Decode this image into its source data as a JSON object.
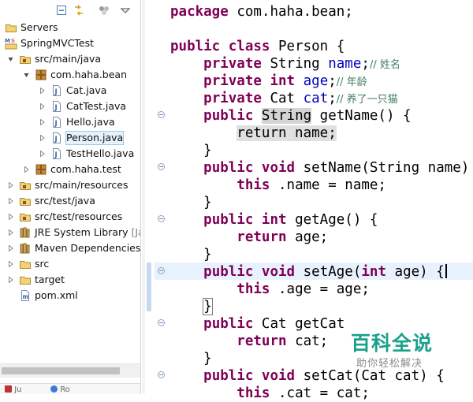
{
  "explorer": {
    "toolbar_icons": [
      "collapse-all-icon",
      "link-with-editor-icon",
      "focus-task-icon",
      "view-menu-icon"
    ],
    "items": [
      {
        "id": "servers",
        "label": "Servers",
        "icon": "folder-icon",
        "arrow": "",
        "indent": 0
      },
      {
        "id": "springmvctest",
        "label": "SpringMVCTest",
        "icon": "web-project-icon",
        "arrow": "",
        "indent": 0
      },
      {
        "id": "src-main-java",
        "label": "src/main/java",
        "icon": "source-folder-icon",
        "arrow": "expanded",
        "indent": 1
      },
      {
        "id": "com-haha-bean",
        "label": "com.haha.bean",
        "icon": "package-icon",
        "arrow": "expanded",
        "indent": 2
      },
      {
        "id": "cat-java",
        "label": "Cat.java",
        "icon": "java-file-icon",
        "arrow": "collapsed",
        "indent": 3
      },
      {
        "id": "cattest-java",
        "label": "CatTest.java",
        "icon": "java-file-icon",
        "arrow": "collapsed",
        "indent": 3
      },
      {
        "id": "hello-java",
        "label": "Hello.java",
        "icon": "java-file-icon",
        "arrow": "collapsed",
        "indent": 3
      },
      {
        "id": "person-java",
        "label": "Person.java",
        "icon": "java-file-icon",
        "arrow": "collapsed",
        "indent": 3,
        "selected": true
      },
      {
        "id": "testhello-java",
        "label": "TestHello.java",
        "icon": "java-file-icon",
        "arrow": "collapsed",
        "indent": 3
      },
      {
        "id": "com-haha-test",
        "label": "com.haha.test",
        "icon": "package-icon",
        "arrow": "collapsed",
        "indent": 2
      },
      {
        "id": "src-main-resources",
        "label": "src/main/resources",
        "icon": "source-folder-icon",
        "arrow": "collapsed",
        "indent": 1
      },
      {
        "id": "src-test-java",
        "label": "src/test/java",
        "icon": "source-folder-icon",
        "arrow": "collapsed",
        "indent": 1
      },
      {
        "id": "src-test-resources",
        "label": "src/test/resources",
        "icon": "source-folder-icon",
        "arrow": "collapsed",
        "indent": 1
      },
      {
        "id": "jre-system-library",
        "label": "JRE System Library ",
        "suffix": "[Ja",
        "icon": "library-icon",
        "arrow": "collapsed",
        "indent": 1
      },
      {
        "id": "maven-dependencies",
        "label": "Maven Dependencies",
        "icon": "library-icon",
        "arrow": "collapsed",
        "indent": 1
      },
      {
        "id": "src",
        "label": "src",
        "icon": "folder-icon",
        "arrow": "collapsed",
        "indent": 1
      },
      {
        "id": "target",
        "label": "target",
        "icon": "folder-icon",
        "arrow": "collapsed",
        "indent": 1
      },
      {
        "id": "pom-xml",
        "label": "pom.xml",
        "icon": "maven-pom-icon",
        "arrow": "",
        "indent": 1
      }
    ],
    "bottom_tabs": [
      "Ju",
      "Ro"
    ]
  },
  "editor": {
    "lines": [
      {
        "n": 1,
        "segs": [
          [
            "kw",
            "package"
          ],
          [
            "",
            "com.haha.bean;"
          ]
        ]
      },
      {
        "n": 2,
        "segs": []
      },
      {
        "n": 3,
        "segs": [
          [
            "kw",
            "public"
          ],
          [
            "kw",
            "class"
          ],
          [
            "",
            "Person {"
          ]
        ]
      },
      {
        "n": 4,
        "segs": [
          [
            "",
            "    "
          ],
          [
            "kw",
            "private"
          ],
          [
            "",
            "String "
          ],
          [
            "fld",
            "name"
          ],
          [
            "",
            ";"
          ],
          [
            "cm",
            "// 姓名"
          ]
        ]
      },
      {
        "n": 5,
        "segs": [
          [
            "",
            "    "
          ],
          [
            "kw",
            "private"
          ],
          [
            "kw",
            "int"
          ],
          [
            "fld",
            "age"
          ],
          [
            "",
            ";"
          ],
          [
            "cm",
            "// 年龄"
          ]
        ]
      },
      {
        "n": 6,
        "segs": [
          [
            "",
            "    "
          ],
          [
            "kw",
            "private"
          ],
          [
            "",
            "Cat "
          ],
          [
            "fld",
            "cat"
          ],
          [
            "",
            ";"
          ],
          [
            "cm",
            "// 养了一只猫"
          ]
        ]
      },
      {
        "n": 7,
        "segs": [
          [
            "",
            "    "
          ],
          [
            "kw",
            "public"
          ],
          [
            "occ",
            "String"
          ],
          [
            "",
            " getName() {"
          ]
        ]
      },
      {
        "n": 8,
        "segs": [
          [
            "",
            "        "
          ],
          [
            "ret",
            "return name;"
          ]
        ]
      },
      {
        "n": 9,
        "segs": [
          [
            "",
            "    }"
          ]
        ]
      },
      {
        "n": 10,
        "segs": [
          [
            "",
            "    "
          ],
          [
            "kw",
            "public"
          ],
          [
            "kw",
            "void"
          ],
          [
            "",
            "setName(String name) {"
          ]
        ]
      },
      {
        "n": 11,
        "segs": [
          [
            "",
            "        "
          ],
          [
            "kw",
            "this"
          ],
          [
            "",
            ".name = name;"
          ]
        ]
      },
      {
        "n": 12,
        "segs": [
          [
            "",
            "    }"
          ]
        ]
      },
      {
        "n": 13,
        "segs": [
          [
            "",
            "    "
          ],
          [
            "kw",
            "public"
          ],
          [
            "kw",
            "int"
          ],
          [
            "",
            "getAge() {"
          ]
        ]
      },
      {
        "n": 14,
        "segs": [
          [
            "",
            "        "
          ],
          [
            "kw",
            "return"
          ],
          [
            "",
            "age;"
          ]
        ]
      },
      {
        "n": 15,
        "segs": [
          [
            "",
            "    }"
          ]
        ]
      },
      {
        "n": 16,
        "segs": [
          [
            "",
            "    "
          ],
          [
            "kw",
            "public"
          ],
          [
            "kw",
            "void"
          ],
          [
            "",
            "setAge("
          ],
          [
            "kw",
            "int"
          ],
          [
            "",
            "age) {"
          ]
        ]
      },
      {
        "n": 17,
        "segs": [
          [
            "",
            "        "
          ],
          [
            "kw",
            "this"
          ],
          [
            "",
            ".age = age;"
          ]
        ]
      },
      {
        "n": 18,
        "segs": [
          [
            "",
            "    }"
          ]
        ]
      },
      {
        "n": 19,
        "segs": [
          [
            "",
            "    "
          ],
          [
            "kw",
            "public"
          ],
          [
            "",
            "Cat getCat"
          ]
        ]
      },
      {
        "n": 20,
        "segs": [
          [
            "",
            "        "
          ],
          [
            "kw",
            "return"
          ],
          [
            "",
            "cat;"
          ]
        ]
      },
      {
        "n": 21,
        "segs": [
          [
            "",
            "    }"
          ]
        ]
      },
      {
        "n": 22,
        "segs": [
          [
            "",
            "    "
          ],
          [
            "kw",
            "public"
          ],
          [
            "kw",
            "void"
          ],
          [
            "",
            "setCat(Cat cat) {"
          ]
        ]
      },
      {
        "n": 23,
        "segs": [
          [
            "",
            "        "
          ],
          [
            "kw",
            "this"
          ],
          [
            "",
            ".cat = cat;"
          ]
        ]
      }
    ]
  },
  "watermark": {
    "title": "百科全说",
    "subtitle": "助你轻松解决"
  },
  "colors": {
    "keyword": "#7f0055",
    "field": "#0000c0",
    "comment": "#3f7f5f",
    "current_line": "#e8f2fe",
    "watermark": "#1aa08c"
  }
}
